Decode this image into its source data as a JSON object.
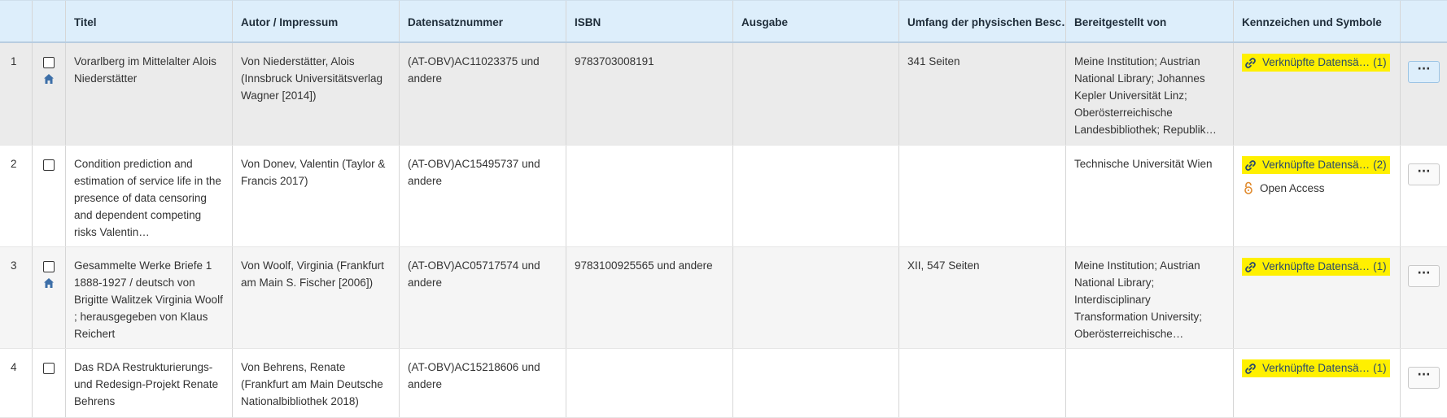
{
  "columns": {
    "num": "",
    "select": "",
    "title": "Titel",
    "author": "Autor / Impressum",
    "record_id": "Datensatznummer",
    "isbn": "ISBN",
    "edition": "Ausgabe",
    "extent": "Umfang der physischen Besc…",
    "provided_by": "Bereitgestellt von",
    "symbols": "Kennzeichen und Symbole"
  },
  "colors": {
    "header_bg": "#ddeefb",
    "highlight": "#fff000",
    "link_icon": "#2b4a6b",
    "home_icon": "#3d6fa8",
    "open_access_icon": "#e08a2c"
  },
  "rows": [
    {
      "num": "1",
      "home_icon": "home-icon",
      "title": "Vorarlberg im Mittelalter Alois Niederstätter",
      "author": "Von Niederstätter, Alois (Innsbruck Universitätsverlag Wagner [2014])",
      "record_id": "(AT-OBV)AC11023375 und andere",
      "isbn": "9783703008191",
      "edition": "",
      "extent": "341 Seiten",
      "provided_by": "Meine Institution; Austrian National Library; Johannes Kepler Universität Linz; Oberösterreichische Landesbibliothek; Republik…",
      "linked_label": "Verknüpfte Datensä…",
      "linked_count": "(1)",
      "open_access": "",
      "more": "···"
    },
    {
      "num": "2",
      "home_icon": "",
      "title": "Condition prediction and estimation of service life in the presence of data censoring and dependent competing risks Valentin…",
      "author": "Von Donev, Valentin (Taylor & Francis 2017)",
      "record_id": "(AT-OBV)AC15495737 und andere",
      "isbn": "",
      "edition": "",
      "extent": "",
      "provided_by": "Technische Universität Wien",
      "linked_label": "Verknüpfte Datensä…",
      "linked_count": "(2)",
      "open_access": "Open Access",
      "more": "···"
    },
    {
      "num": "3",
      "home_icon": "home-icon",
      "title": "Gesammelte Werke Briefe 1 1888-1927 / deutsch von Brigitte Walitzek Virginia Woolf ; herausgegeben von Klaus Reichert",
      "author": "Von Woolf, Virginia (Frankfurt am Main S. Fischer [2006])",
      "record_id": "(AT-OBV)AC05717574 und andere",
      "isbn": "9783100925565 und andere",
      "edition": "",
      "extent": "XII, 547 Seiten",
      "provided_by": "Meine Institution; Austrian National Library; Interdisciplinary Transformation University; Oberösterreichische…",
      "linked_label": "Verknüpfte Datensä…",
      "linked_count": "(1)",
      "open_access": "",
      "more": "···"
    },
    {
      "num": "4",
      "home_icon": "",
      "title": "Das RDA Restrukturierungs- und Redesign-Projekt Renate Behrens",
      "author": "Von Behrens, Renate (Frankfurt am Main Deutsche Nationalbibliothek 2018)",
      "record_id": "(AT-OBV)AC15218606 und andere",
      "isbn": "",
      "edition": "",
      "extent": "",
      "provided_by": "",
      "linked_label": "Verknüpfte Datensä…",
      "linked_count": "(1)",
      "open_access": "",
      "more": "···"
    }
  ]
}
